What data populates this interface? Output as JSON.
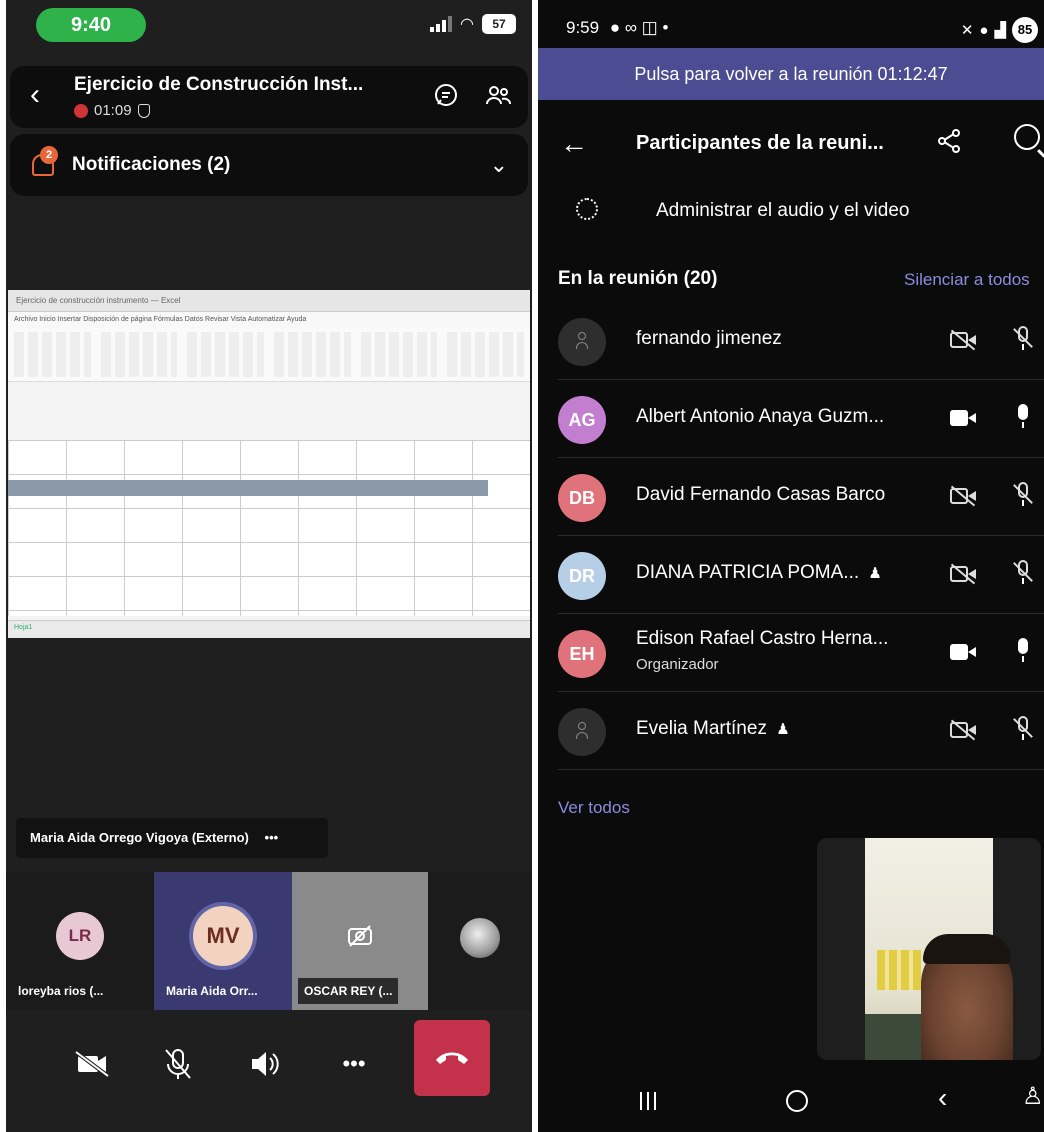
{
  "left": {
    "status": {
      "time": "9:40",
      "battery": "57"
    },
    "header": {
      "title": "Ejercicio de Construcción Inst...",
      "timer": "01:09"
    },
    "notifications": {
      "label": "Notificaciones (2)",
      "badge": "2"
    },
    "shared_screen": {
      "toolbar_text": "Ejercicio de construcción instrumento — Excel",
      "menu_text": "Archivo   Inicio   Insertar   Disposición de página   Fórmulas   Datos   Revisar   Vista   Automatizar   Ayuda",
      "sheet_tab": "Hoja1"
    },
    "speaker_chip": "Maria Aida Orrego Vigoya (Externo)",
    "speaker_more": "•••",
    "tiles": [
      {
        "initials": "LR",
        "name": "loreyba rios (...",
        "avatar_bg": "#e8c9d3",
        "avatar_fg": "#7a2a48"
      },
      {
        "initials": "MV",
        "name": "Maria Aida Orr...",
        "avatar_bg": "#f3d2c0",
        "avatar_fg": "#6a2d1f"
      },
      {
        "initials": "",
        "name": "OSCAR REY (...",
        "avatar_bg": "#8a8a8a",
        "avatar_fg": "#ffffff"
      },
      {
        "initials": "",
        "name": "",
        "avatar_bg": "#cfcfcf",
        "avatar_fg": "#333"
      }
    ],
    "controls": {
      "camera": "camera-off",
      "mic": "mic-off",
      "speaker": "speaker",
      "more": "•••",
      "hangup": "hang-up"
    }
  },
  "right": {
    "status": {
      "time": "9:59",
      "battery": "85"
    },
    "banner": "Pulsa para volver a la reunión 01:12:47",
    "header": {
      "title": "Participantes de la reuni..."
    },
    "manage_av": "Administrar el audio y el video",
    "in_meeting": "En la reunión (20)",
    "mute_all": "Silenciar a todos",
    "participants": [
      {
        "initials": "",
        "name": "fernando jimenez",
        "role": "",
        "avatar_bg": "#2e2e2e",
        "camera": "off",
        "mic": "off"
      },
      {
        "initials": "AG",
        "name": "Albert Antonio Anaya Guzm...",
        "role": "",
        "avatar_bg": "#c27fd0",
        "camera": "on",
        "mic": "on"
      },
      {
        "initials": "DB",
        "name": "David Fernando Casas Barco",
        "role": "",
        "avatar_bg": "#e0727c",
        "camera": "off",
        "mic": "off"
      },
      {
        "initials": "DR",
        "name": "DIANA PATRICIA POMA...",
        "role": "",
        "avatar_bg": "#b7cfe6",
        "camera": "off",
        "mic": "off"
      },
      {
        "initials": "EH",
        "name": "Edison Rafael Castro Herna...",
        "role": "Organizador",
        "avatar_bg": "#e0727c",
        "camera": "on",
        "mic": "on"
      },
      {
        "initials": "",
        "name": "Evelia Martínez",
        "role": "",
        "avatar_bg": "#2e2e2e",
        "camera": "off",
        "mic": "off"
      }
    ],
    "see_all": "Ver todos"
  }
}
